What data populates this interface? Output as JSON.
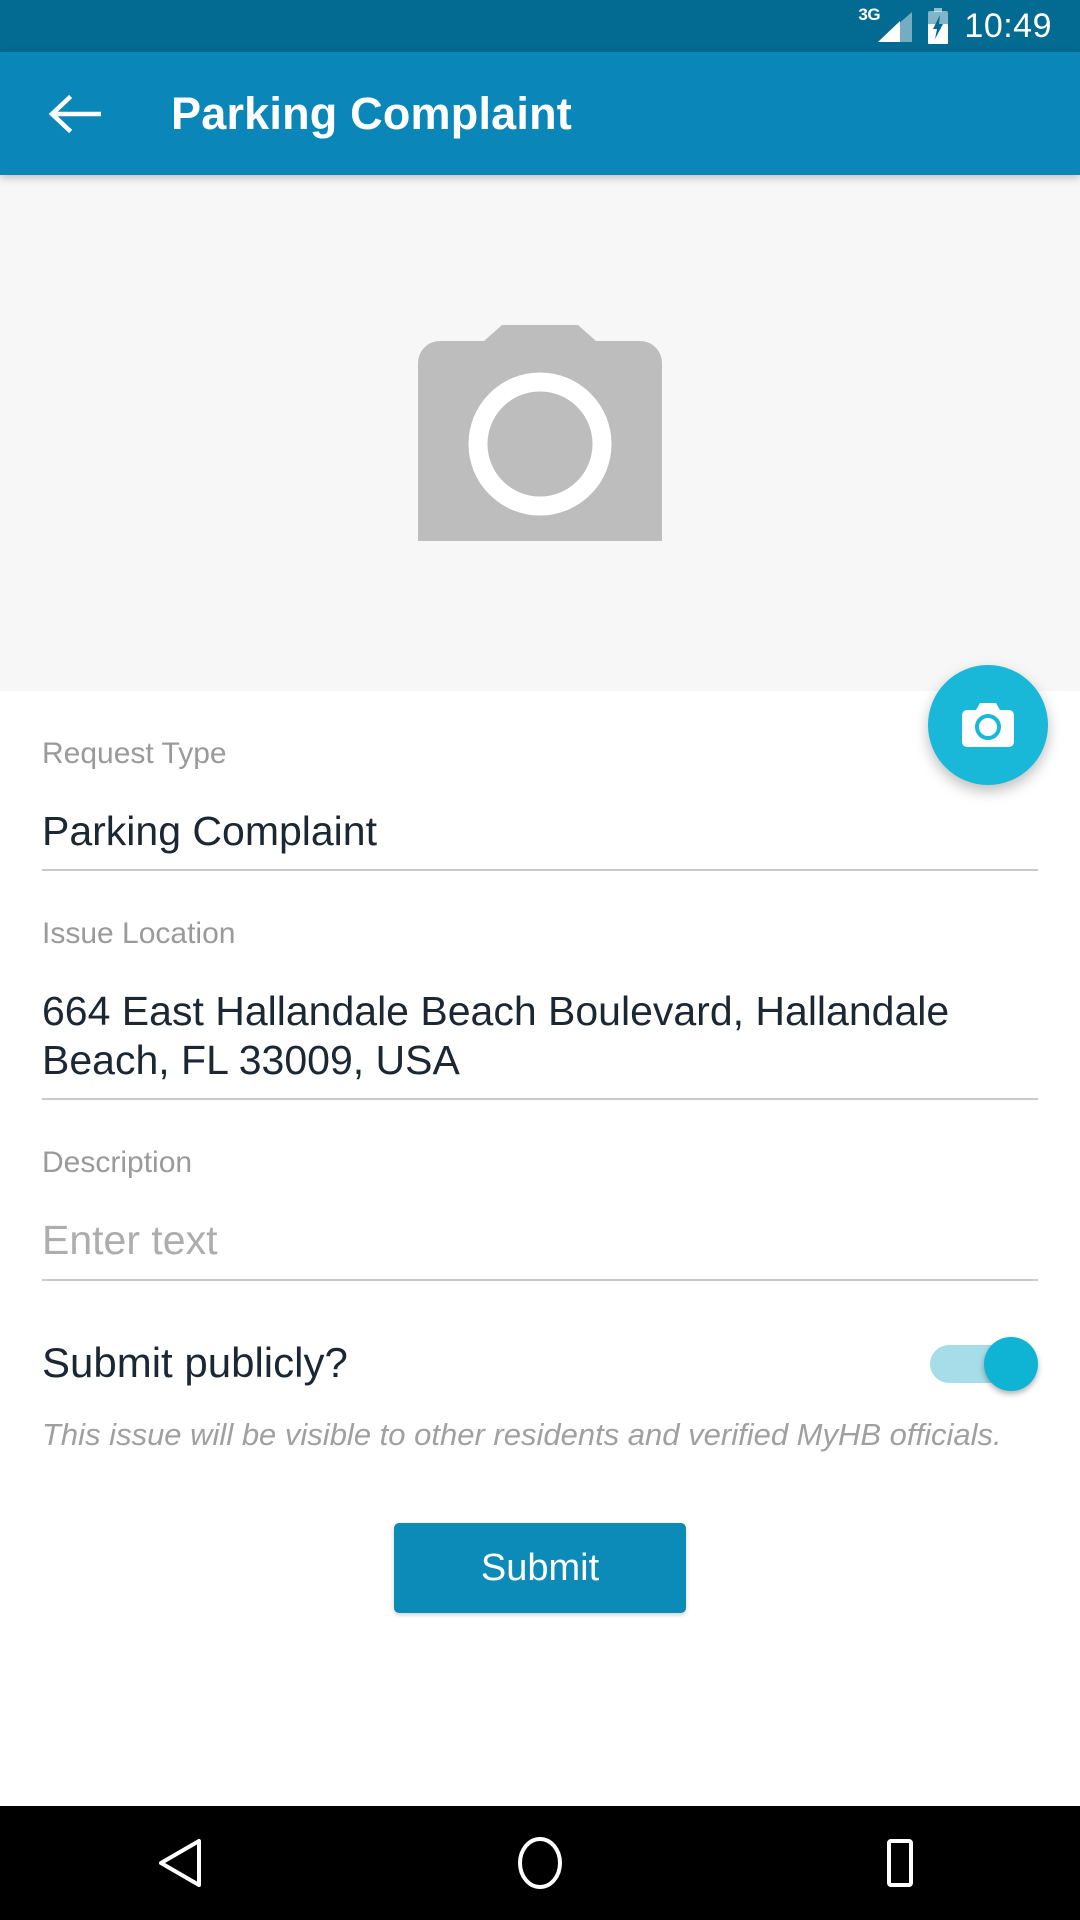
{
  "status_bar": {
    "network_label": "3G",
    "signal_icon": "signal-bars-icon",
    "battery_icon": "battery-charging-icon",
    "clock": "10:49",
    "background_color": "#036a91"
  },
  "app_bar": {
    "back_icon": "arrow-left-icon",
    "title": "Parking Complaint",
    "background_color": "#0b86b8"
  },
  "photo_area": {
    "placeholder_icon": "camera-placeholder-icon",
    "background_color": "#f7f7f7",
    "fab": {
      "icon": "camera-icon",
      "color": "#19b8d8"
    }
  },
  "form": {
    "request_type": {
      "label": "Request Type",
      "value": "Parking Complaint"
    },
    "issue_location": {
      "label": "Issue Location",
      "value": "664 East Hallandale Beach Boulevard, Hallandale Beach, FL 33009, USA"
    },
    "description": {
      "label": "Description",
      "placeholder": "Enter text",
      "value": ""
    },
    "submit_publicly": {
      "label": "Submit publicly?",
      "toggle_state": "on",
      "hint": "This issue will be visible to other residents and verified MyHB officials.",
      "track_color": "#a6dde8",
      "thumb_color": "#0fb4d4"
    },
    "submit_button": {
      "label": "Submit",
      "color": "#0c8bb8"
    }
  },
  "nav_bar": {
    "back_icon": "nav-back-triangle-icon",
    "home_icon": "nav-home-circle-icon",
    "recents_icon": "nav-recents-square-icon"
  }
}
